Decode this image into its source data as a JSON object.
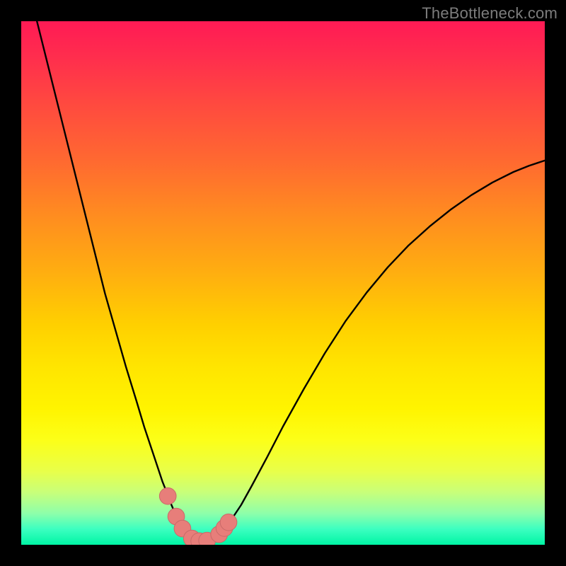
{
  "watermark": "TheBottleneck.com",
  "colors": {
    "frame": "#000000",
    "curve": "#000000",
    "marker_fill": "#e77e7a",
    "marker_stroke": "#c96a68"
  },
  "chart_data": {
    "type": "line",
    "title": "",
    "xlabel": "",
    "ylabel": "",
    "xlim": [
      0,
      100
    ],
    "ylim": [
      0,
      100
    ],
    "grid": false,
    "series": [
      {
        "name": "left-curve",
        "x": [
          3,
          6,
          8,
          10,
          12,
          14,
          16,
          18,
          20,
          22,
          23.5,
          25,
          26,
          27,
          28,
          28.7,
          29.3,
          29.8,
          30.2,
          30.6,
          31,
          31.5,
          32,
          32.8,
          33.8
        ],
        "y": [
          100,
          88,
          80,
          72,
          64,
          56,
          48,
          41,
          34,
          27.5,
          22.5,
          18,
          15,
          12,
          9.5,
          7.6,
          6.2,
          5.1,
          4.2,
          3.5,
          2.9,
          2.3,
          1.8,
          1.2,
          0.7
        ]
      },
      {
        "name": "right-curve",
        "x": [
          36,
          37,
          38,
          39,
          40,
          42,
          44,
          47,
          50,
          54,
          58,
          62,
          66,
          70,
          74,
          78,
          82,
          86,
          90,
          94,
          97,
          100
        ],
        "y": [
          0.9,
          1.5,
          2.3,
          3.3,
          4.6,
          7.6,
          11.2,
          16.8,
          22.6,
          29.8,
          36.6,
          42.8,
          48.2,
          53,
          57.2,
          60.8,
          64,
          66.8,
          69.2,
          71.2,
          72.4,
          73.4
        ]
      }
    ],
    "markers": [
      {
        "x": 28.0,
        "y": 9.3,
        "r": 1.6
      },
      {
        "x": 29.6,
        "y": 5.4,
        "r": 1.6
      },
      {
        "x": 30.8,
        "y": 3.1,
        "r": 1.6
      },
      {
        "x": 32.6,
        "y": 1.2,
        "r": 1.6
      },
      {
        "x": 34.0,
        "y": 0.7,
        "r": 1.6
      },
      {
        "x": 35.5,
        "y": 0.8,
        "r": 1.6
      },
      {
        "x": 37.8,
        "y": 2.0,
        "r": 1.6
      },
      {
        "x": 38.8,
        "y": 3.2,
        "r": 1.6
      },
      {
        "x": 39.6,
        "y": 4.3,
        "r": 1.6
      }
    ],
    "annotations": []
  }
}
